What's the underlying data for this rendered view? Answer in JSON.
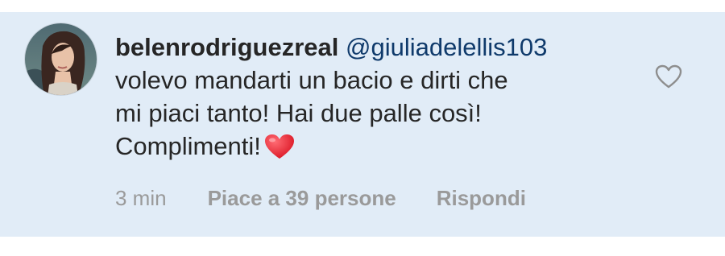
{
  "comment": {
    "username": "belenrodriguezreal",
    "mention": "@giuliadelellis103",
    "text_line1": " volevo mandarti un bacio e dirti che",
    "text_line2": "mi piaci tanto! Hai due palle così!",
    "text_line3": "Complimenti!",
    "emoji": "red-heart-emoji",
    "time": "3 min",
    "likes_label": "Piace a 39 persone",
    "reply_label": "Rispondi"
  },
  "icons": {
    "like": "heart-outline-icon",
    "avatar": "user-avatar"
  },
  "colors": {
    "comment_background": "#e1ecf7",
    "mention": "#0f3a6b",
    "meta_text": "#9a9a9a",
    "heart_emoji": "#e0202e"
  }
}
